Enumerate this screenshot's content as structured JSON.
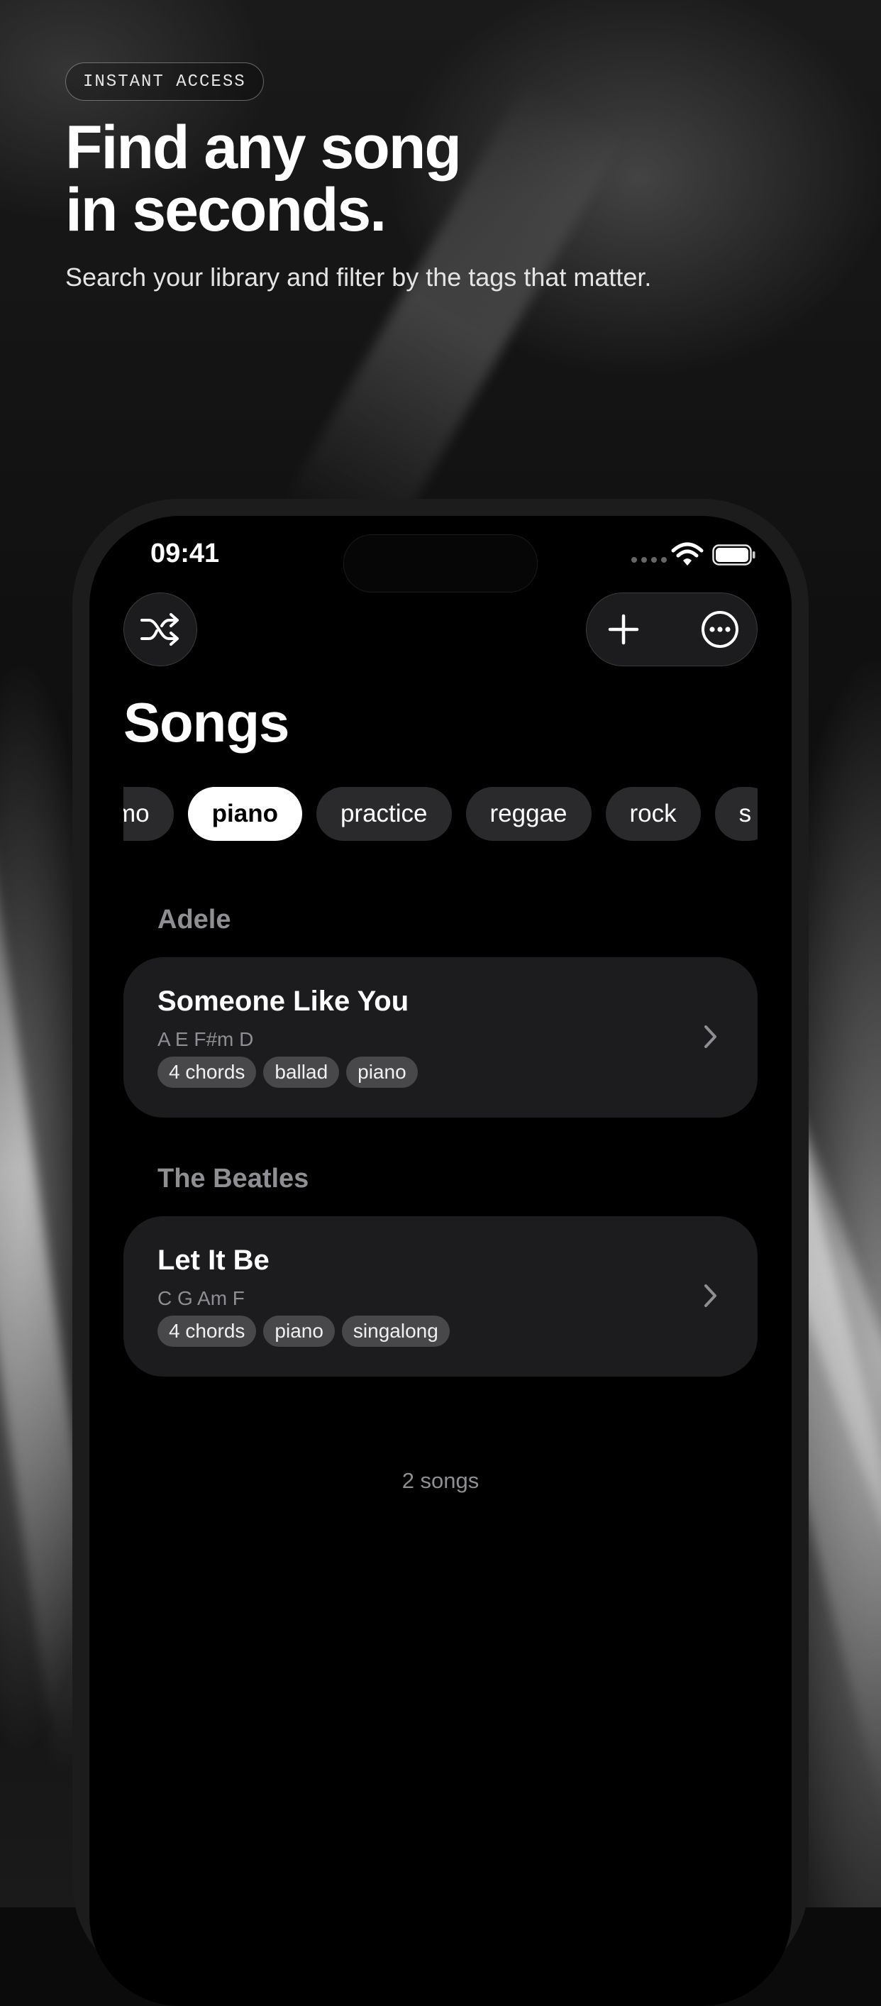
{
  "promo": {
    "badge": "INSTANT ACCESS",
    "headline_line1": "Find any song",
    "headline_line2": "in seconds.",
    "subheadline": "Search your library and filter by the tags that matter."
  },
  "status_bar": {
    "time": "09:41"
  },
  "toolbar": {
    "shuffle_icon": "shuffle-icon",
    "add_icon": "plus-icon",
    "more_icon": "ellipsis-circle-icon"
  },
  "page": {
    "title": "Songs"
  },
  "filters": {
    "chips": [
      {
        "label": "mo",
        "active": false
      },
      {
        "label": "piano",
        "active": true
      },
      {
        "label": "practice",
        "active": false
      },
      {
        "label": "reggae",
        "active": false
      },
      {
        "label": "rock",
        "active": false
      },
      {
        "label": "s",
        "active": false
      }
    ]
  },
  "sections": [
    {
      "artist": "Adele",
      "songs": [
        {
          "title": "Someone Like You",
          "chords": "A E F#m D",
          "tags": [
            "4 chords",
            "ballad",
            "piano"
          ]
        }
      ]
    },
    {
      "artist": "The Beatles",
      "songs": [
        {
          "title": "Let It Be",
          "chords": "C G Am F",
          "tags": [
            "4 chords",
            "piano",
            "singalong"
          ]
        }
      ]
    }
  ],
  "footer": {
    "count": "2 songs"
  },
  "colors": {
    "background": "#000000",
    "card": "#1c1c1e",
    "secondary_text": "#8e8e93",
    "tag": "#48484a"
  }
}
